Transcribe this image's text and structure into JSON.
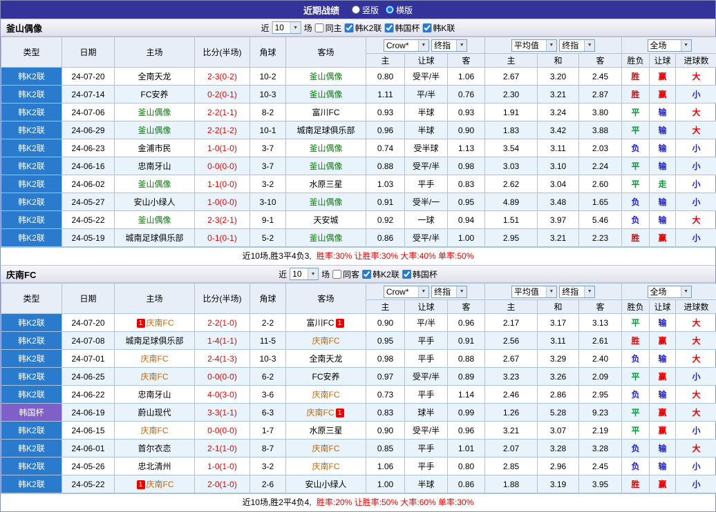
{
  "topbar": {
    "title": "近期战绩",
    "radios": [
      {
        "label": "竖版",
        "selected": false
      },
      {
        "label": "横版",
        "selected": true
      }
    ]
  },
  "table_header": {
    "cols": [
      "类型",
      "日期",
      "主场",
      "比分(半场)",
      "角球",
      "客场"
    ],
    "selects": {
      "bookmaker": "Crow*",
      "stage1": "终指",
      "average": "平均值",
      "stage2": "终指",
      "scope": "全场"
    },
    "sub": [
      "主",
      "让球",
      "客",
      "主",
      "和",
      "客",
      "胜负",
      "让球",
      "进球数"
    ]
  },
  "sections": [
    {
      "team": "釜山偶像",
      "team_color": "#008800",
      "filter": {
        "near_label": "近",
        "count": "10",
        "games_label": "场",
        "same": {
          "label": "同主",
          "on": false
        },
        "leagues": [
          {
            "label": "韩K2联",
            "on": true
          },
          {
            "label": "韩国杯",
            "on": true
          },
          {
            "label": "韩K联",
            "on": true
          }
        ]
      },
      "rows": [
        {
          "league": "韩K2联",
          "league_kind": "k2",
          "date": "24-07-20",
          "home": "全南天龙",
          "score": "2-3(0-2)",
          "corner": "10-2",
          "away": "釜山偶像",
          "away_focus": true,
          "odds": [
            "0.80",
            "受平/半",
            "1.06"
          ],
          "avg": [
            "2.67",
            "3.20",
            "2.45"
          ],
          "res": [
            "胜",
            "赢",
            "大"
          ]
        },
        {
          "league": "韩K2联",
          "league_kind": "k2",
          "date": "24-07-14",
          "home": "FC安养",
          "score": "0-2(0-1)",
          "corner": "10-3",
          "away": "釜山偶像",
          "away_focus": true,
          "odds": [
            "1.11",
            "平/半",
            "0.76"
          ],
          "avg": [
            "2.30",
            "3.21",
            "2.87"
          ],
          "res": [
            "胜",
            "赢",
            "小"
          ]
        },
        {
          "league": "韩K2联",
          "league_kind": "k2",
          "date": "24-07-06",
          "home": "釜山偶像",
          "home_focus": true,
          "score": "2-2(1-1)",
          "corner": "8-2",
          "away": "富川FC",
          "odds": [
            "0.93",
            "半球",
            "0.93"
          ],
          "avg": [
            "1.91",
            "3.24",
            "3.80"
          ],
          "res": [
            "平",
            "输",
            "大"
          ]
        },
        {
          "league": "韩K2联",
          "league_kind": "k2",
          "date": "24-06-29",
          "home": "釜山偶像",
          "home_focus": true,
          "score": "2-2(1-2)",
          "corner": "10-1",
          "away": "城南足球俱乐部",
          "odds": [
            "0.96",
            "半球",
            "0.90"
          ],
          "avg": [
            "1.83",
            "3.42",
            "3.88"
          ],
          "res": [
            "平",
            "输",
            "大"
          ]
        },
        {
          "league": "韩K2联",
          "league_kind": "k2",
          "date": "24-06-23",
          "home": "金浦市民",
          "score": "1-0(1-0)",
          "corner": "3-7",
          "away": "釜山偶像",
          "away_focus": true,
          "odds": [
            "0.74",
            "受半球",
            "1.13"
          ],
          "avg": [
            "3.54",
            "3.11",
            "2.03"
          ],
          "res": [
            "负",
            "输",
            "小"
          ]
        },
        {
          "league": "韩K2联",
          "league_kind": "k2",
          "date": "24-06-16",
          "home": "忠南牙山",
          "score": "0-0(0-0)",
          "corner": "3-7",
          "away": "釜山偶像",
          "away_focus": true,
          "odds": [
            "0.88",
            "受平/半",
            "0.98"
          ],
          "avg": [
            "3.03",
            "3.10",
            "2.24"
          ],
          "res": [
            "平",
            "输",
            "小"
          ]
        },
        {
          "league": "韩K2联",
          "league_kind": "k2",
          "date": "24-06-02",
          "home": "釜山偶像",
          "home_focus": true,
          "score": "1-1(0-0)",
          "corner": "3-2",
          "away": "水原三星",
          "odds": [
            "1.03",
            "平手",
            "0.83"
          ],
          "avg": [
            "2.62",
            "3.04",
            "2.60"
          ],
          "res": [
            "平",
            "走",
            "小"
          ]
        },
        {
          "league": "韩K2联",
          "league_kind": "k2",
          "date": "24-05-27",
          "home": "安山小绿人",
          "score": "1-0(0-0)",
          "corner": "3-10",
          "away": "釜山偶像",
          "away_focus": true,
          "odds": [
            "0.91",
            "受半/一",
            "0.95"
          ],
          "avg": [
            "4.89",
            "3.48",
            "1.65"
          ],
          "res": [
            "负",
            "输",
            "小"
          ]
        },
        {
          "league": "韩K2联",
          "league_kind": "k2",
          "date": "24-05-22",
          "home": "釜山偶像",
          "home_focus": true,
          "score": "2-3(2-1)",
          "corner": "9-1",
          "away": "天安城",
          "odds": [
            "0.92",
            "一球",
            "0.94"
          ],
          "avg": [
            "1.51",
            "3.97",
            "5.46"
          ],
          "res": [
            "负",
            "输",
            "大"
          ]
        },
        {
          "league": "韩K2联",
          "league_kind": "k2",
          "date": "24-05-19",
          "home": "城南足球俱乐部",
          "score": "0-1(0-1)",
          "corner": "5-2",
          "away": "釜山偶像",
          "away_focus": true,
          "odds": [
            "0.86",
            "受平/半",
            "1.00"
          ],
          "avg": [
            "2.95",
            "3.21",
            "2.23"
          ],
          "res": [
            "胜",
            "赢",
            "小"
          ]
        }
      ],
      "summary": {
        "lead": "近10场,胜3平4负3,",
        "rates": "胜率:30% 让胜率:30% 大率:40% 单率:50%"
      }
    },
    {
      "team": "庆南FC",
      "team_color": "#cc6600",
      "filter": {
        "near_label": "近",
        "count": "10",
        "games_label": "场",
        "same": {
          "label": "同客",
          "on": false
        },
        "leagues": [
          {
            "label": "韩K2联",
            "on": true
          },
          {
            "label": "韩国杯",
            "on": true
          }
        ]
      },
      "rows": [
        {
          "league": "韩K2联",
          "league_kind": "k2",
          "date": "24-07-20",
          "home": "庆南FC",
          "home_focus": true,
          "home_badge_before": "1",
          "score": "2-2(1-0)",
          "corner": "2-2",
          "away": "富川FC",
          "away_badge_after": "1",
          "odds": [
            "0.90",
            "平/半",
            "0.96"
          ],
          "avg": [
            "2.17",
            "3.17",
            "3.13"
          ],
          "res": [
            "平",
            "输",
            "大"
          ]
        },
        {
          "league": "韩K2联",
          "league_kind": "k2",
          "date": "24-07-08",
          "home": "城南足球俱乐部",
          "score": "1-4(1-1)",
          "corner": "11-5",
          "away": "庆南FC",
          "away_focus": true,
          "odds": [
            "0.95",
            "平手",
            "0.91"
          ],
          "avg": [
            "2.56",
            "3.11",
            "2.61"
          ],
          "res": [
            "胜",
            "赢",
            "大"
          ]
        },
        {
          "league": "韩K2联",
          "league_kind": "k2",
          "date": "24-07-01",
          "home": "庆南FC",
          "home_focus": true,
          "score": "2-4(1-3)",
          "corner": "10-3",
          "away": "全南天龙",
          "odds": [
            "0.98",
            "平手",
            "0.88"
          ],
          "avg": [
            "2.67",
            "3.29",
            "2.40"
          ],
          "res": [
            "负",
            "输",
            "大"
          ]
        },
        {
          "league": "韩K2联",
          "league_kind": "k2",
          "date": "24-06-25",
          "home": "庆南FC",
          "home_focus": true,
          "score": "0-0(0-0)",
          "corner": "6-2",
          "away": "FC安养",
          "odds": [
            "0.97",
            "受平/半",
            "0.89"
          ],
          "avg": [
            "3.23",
            "3.26",
            "2.09"
          ],
          "res": [
            "平",
            "赢",
            "小"
          ]
        },
        {
          "league": "韩K2联",
          "league_kind": "k2",
          "date": "24-06-22",
          "home": "忠南牙山",
          "score": "4-0(3-0)",
          "corner": "3-6",
          "away": "庆南FC",
          "away_focus": true,
          "odds": [
            "0.73",
            "平手",
            "1.14"
          ],
          "avg": [
            "2.46",
            "2.86",
            "2.95"
          ],
          "res": [
            "负",
            "输",
            "大"
          ]
        },
        {
          "league": "韩国杯",
          "league_kind": "cup",
          "date": "24-06-19",
          "home": "蔚山现代",
          "score": "3-3(1-1)",
          "corner": "6-3",
          "away": "庆南FC",
          "away_focus": true,
          "away_badge_after": "1",
          "odds": [
            "0.83",
            "球半",
            "0.99"
          ],
          "avg": [
            "1.26",
            "5.28",
            "9.23"
          ],
          "res": [
            "平",
            "赢",
            "大"
          ]
        },
        {
          "league": "韩K2联",
          "league_kind": "k2",
          "date": "24-06-15",
          "home": "庆南FC",
          "home_focus": true,
          "score": "0-0(0-0)",
          "corner": "1-7",
          "away": "水原三星",
          "odds": [
            "0.90",
            "受平/半",
            "0.96"
          ],
          "avg": [
            "3.21",
            "3.07",
            "2.19"
          ],
          "res": [
            "平",
            "赢",
            "小"
          ]
        },
        {
          "league": "韩K2联",
          "league_kind": "k2",
          "date": "24-06-01",
          "home": "首尔衣恋",
          "score": "2-1(1-0)",
          "corner": "8-7",
          "away": "庆南FC",
          "away_focus": true,
          "odds": [
            "0.85",
            "平手",
            "1.01"
          ],
          "avg": [
            "2.07",
            "3.28",
            "3.28"
          ],
          "res": [
            "负",
            "输",
            "大"
          ]
        },
        {
          "league": "韩K2联",
          "league_kind": "k2",
          "date": "24-05-26",
          "home": "忠北清州",
          "score": "1-0(1-0)",
          "corner": "3-2",
          "away": "庆南FC",
          "away_focus": true,
          "odds": [
            "1.06",
            "平手",
            "0.80"
          ],
          "avg": [
            "2.85",
            "2.96",
            "2.45"
          ],
          "res": [
            "负",
            "输",
            "小"
          ]
        },
        {
          "league": "韩K2联",
          "league_kind": "k2",
          "date": "24-05-22",
          "home": "庆南FC",
          "home_focus": true,
          "home_badge_before": "1",
          "score": "2-0(1-0)",
          "corner": "2-6",
          "away": "安山小绿人",
          "odds": [
            "1.00",
            "半球",
            "0.86"
          ],
          "avg": [
            "1.88",
            "3.19",
            "3.95"
          ],
          "res": [
            "胜",
            "赢",
            "小"
          ]
        }
      ],
      "summary": {
        "lead": "近10场,胜2平4负4,",
        "rates": "胜率:20% 让胜率:50% 大率:60% 单率:30%"
      }
    }
  ],
  "palette": {
    "topbar_bg": "#333399",
    "header_bg": "#e7eef7",
    "border": "#aac4dd",
    "league_k2": "#2a7bcd",
    "league_cup": "#7e60c8",
    "row_alt": "#e9f3fb",
    "score_red": "#e60000",
    "result_colors": {
      "胜": "#e60000",
      "赢": "#e60000",
      "大": "#e60000",
      "平": "#009933",
      "走": "#009933",
      "负": "#2222cc",
      "输": "#2222cc",
      "小": "#2222cc"
    }
  }
}
